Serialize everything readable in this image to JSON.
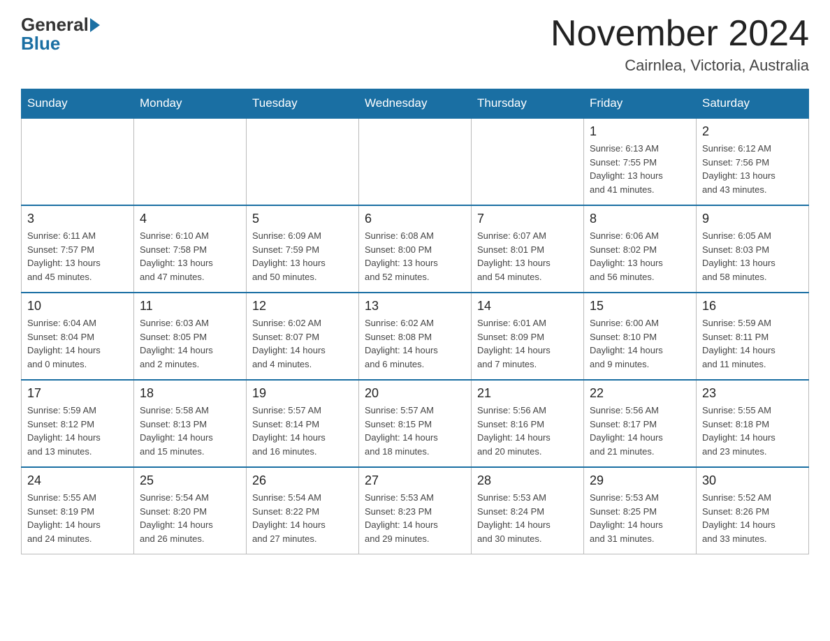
{
  "header": {
    "logo_general": "General",
    "logo_blue": "Blue",
    "month_title": "November 2024",
    "location": "Cairnlea, Victoria, Australia"
  },
  "days_of_week": [
    "Sunday",
    "Monday",
    "Tuesday",
    "Wednesday",
    "Thursday",
    "Friday",
    "Saturday"
  ],
  "weeks": [
    [
      {
        "day": "",
        "info": ""
      },
      {
        "day": "",
        "info": ""
      },
      {
        "day": "",
        "info": ""
      },
      {
        "day": "",
        "info": ""
      },
      {
        "day": "",
        "info": ""
      },
      {
        "day": "1",
        "info": "Sunrise: 6:13 AM\nSunset: 7:55 PM\nDaylight: 13 hours\nand 41 minutes."
      },
      {
        "day": "2",
        "info": "Sunrise: 6:12 AM\nSunset: 7:56 PM\nDaylight: 13 hours\nand 43 minutes."
      }
    ],
    [
      {
        "day": "3",
        "info": "Sunrise: 6:11 AM\nSunset: 7:57 PM\nDaylight: 13 hours\nand 45 minutes."
      },
      {
        "day": "4",
        "info": "Sunrise: 6:10 AM\nSunset: 7:58 PM\nDaylight: 13 hours\nand 47 minutes."
      },
      {
        "day": "5",
        "info": "Sunrise: 6:09 AM\nSunset: 7:59 PM\nDaylight: 13 hours\nand 50 minutes."
      },
      {
        "day": "6",
        "info": "Sunrise: 6:08 AM\nSunset: 8:00 PM\nDaylight: 13 hours\nand 52 minutes."
      },
      {
        "day": "7",
        "info": "Sunrise: 6:07 AM\nSunset: 8:01 PM\nDaylight: 13 hours\nand 54 minutes."
      },
      {
        "day": "8",
        "info": "Sunrise: 6:06 AM\nSunset: 8:02 PM\nDaylight: 13 hours\nand 56 minutes."
      },
      {
        "day": "9",
        "info": "Sunrise: 6:05 AM\nSunset: 8:03 PM\nDaylight: 13 hours\nand 58 minutes."
      }
    ],
    [
      {
        "day": "10",
        "info": "Sunrise: 6:04 AM\nSunset: 8:04 PM\nDaylight: 14 hours\nand 0 minutes."
      },
      {
        "day": "11",
        "info": "Sunrise: 6:03 AM\nSunset: 8:05 PM\nDaylight: 14 hours\nand 2 minutes."
      },
      {
        "day": "12",
        "info": "Sunrise: 6:02 AM\nSunset: 8:07 PM\nDaylight: 14 hours\nand 4 minutes."
      },
      {
        "day": "13",
        "info": "Sunrise: 6:02 AM\nSunset: 8:08 PM\nDaylight: 14 hours\nand 6 minutes."
      },
      {
        "day": "14",
        "info": "Sunrise: 6:01 AM\nSunset: 8:09 PM\nDaylight: 14 hours\nand 7 minutes."
      },
      {
        "day": "15",
        "info": "Sunrise: 6:00 AM\nSunset: 8:10 PM\nDaylight: 14 hours\nand 9 minutes."
      },
      {
        "day": "16",
        "info": "Sunrise: 5:59 AM\nSunset: 8:11 PM\nDaylight: 14 hours\nand 11 minutes."
      }
    ],
    [
      {
        "day": "17",
        "info": "Sunrise: 5:59 AM\nSunset: 8:12 PM\nDaylight: 14 hours\nand 13 minutes."
      },
      {
        "day": "18",
        "info": "Sunrise: 5:58 AM\nSunset: 8:13 PM\nDaylight: 14 hours\nand 15 minutes."
      },
      {
        "day": "19",
        "info": "Sunrise: 5:57 AM\nSunset: 8:14 PM\nDaylight: 14 hours\nand 16 minutes."
      },
      {
        "day": "20",
        "info": "Sunrise: 5:57 AM\nSunset: 8:15 PM\nDaylight: 14 hours\nand 18 minutes."
      },
      {
        "day": "21",
        "info": "Sunrise: 5:56 AM\nSunset: 8:16 PM\nDaylight: 14 hours\nand 20 minutes."
      },
      {
        "day": "22",
        "info": "Sunrise: 5:56 AM\nSunset: 8:17 PM\nDaylight: 14 hours\nand 21 minutes."
      },
      {
        "day": "23",
        "info": "Sunrise: 5:55 AM\nSunset: 8:18 PM\nDaylight: 14 hours\nand 23 minutes."
      }
    ],
    [
      {
        "day": "24",
        "info": "Sunrise: 5:55 AM\nSunset: 8:19 PM\nDaylight: 14 hours\nand 24 minutes."
      },
      {
        "day": "25",
        "info": "Sunrise: 5:54 AM\nSunset: 8:20 PM\nDaylight: 14 hours\nand 26 minutes."
      },
      {
        "day": "26",
        "info": "Sunrise: 5:54 AM\nSunset: 8:22 PM\nDaylight: 14 hours\nand 27 minutes."
      },
      {
        "day": "27",
        "info": "Sunrise: 5:53 AM\nSunset: 8:23 PM\nDaylight: 14 hours\nand 29 minutes."
      },
      {
        "day": "28",
        "info": "Sunrise: 5:53 AM\nSunset: 8:24 PM\nDaylight: 14 hours\nand 30 minutes."
      },
      {
        "day": "29",
        "info": "Sunrise: 5:53 AM\nSunset: 8:25 PM\nDaylight: 14 hours\nand 31 minutes."
      },
      {
        "day": "30",
        "info": "Sunrise: 5:52 AM\nSunset: 8:26 PM\nDaylight: 14 hours\nand 33 minutes."
      }
    ]
  ]
}
